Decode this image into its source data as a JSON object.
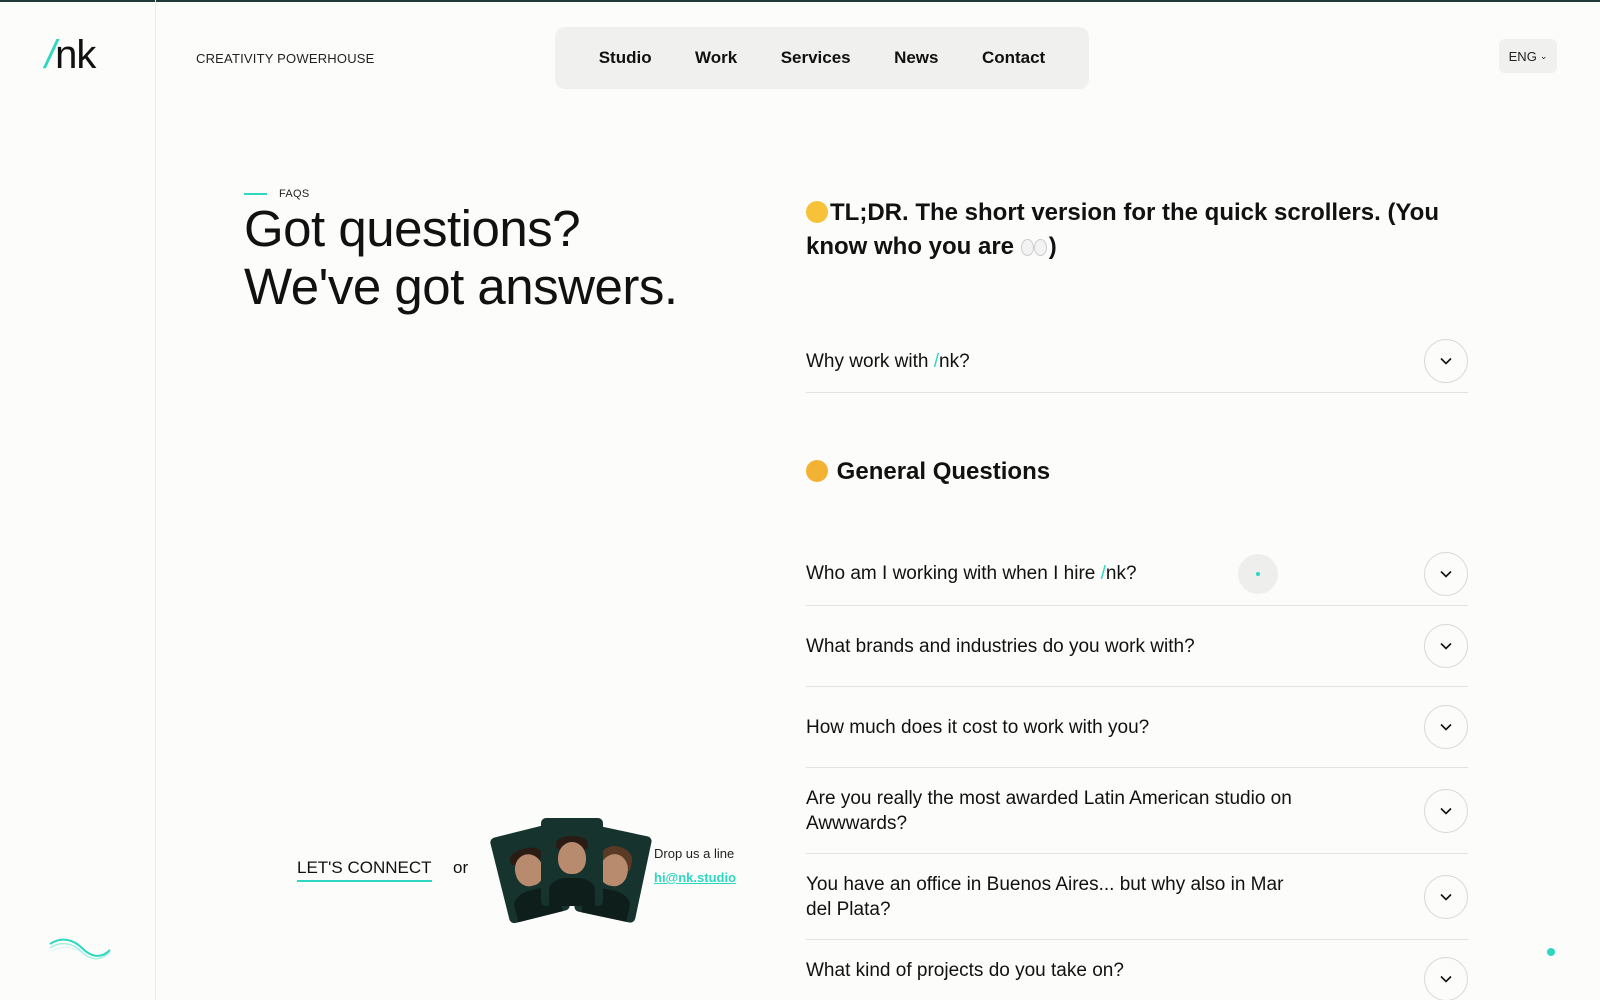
{
  "brand": {
    "logo_slash": "/",
    "logo_text": "nk",
    "tagline": "CREATIVITY POWERHOUSE"
  },
  "nav": {
    "items": [
      "Studio",
      "Work",
      "Services",
      "News",
      "Contact"
    ]
  },
  "language": {
    "label": "ENG",
    "icon": "chevron-down-icon"
  },
  "hero": {
    "eyebrow": "FAQS",
    "title_line1": "Got questions?",
    "title_line2": "We've got answers."
  },
  "contact": {
    "connect_label": "LET'S CONNECT",
    "or_text": "or",
    "drop_label": "Drop us a line",
    "email": "hi@nk.studio"
  },
  "sections": {
    "tldr_title": "TL;DR. The short version for the quick scrollers. (You know who you are",
    "tldr_close": ")",
    "general_title": "General Questions"
  },
  "faqs": {
    "tldr_q1_pre": "Why work with ",
    "tldr_q1_slash": "/",
    "tldr_q1_post": "nk?",
    "g1_pre": "Who am I working with when I hire ",
    "g1_slash": "/",
    "g1_post": "nk?",
    "g2": "What brands and industries do you work with?",
    "g3": "How much does it cost to work with you?",
    "g4": "Are you really the most awarded Latin American studio on Awwwards?",
    "g5": "You have an office in Buenos Aires... but why also in Mar del Plata?",
    "g6": "What kind of projects do you take on?"
  },
  "colors": {
    "accent": "#2fd6c0",
    "background": "#fcfcfa",
    "nav_bg": "#f0f0ee"
  }
}
